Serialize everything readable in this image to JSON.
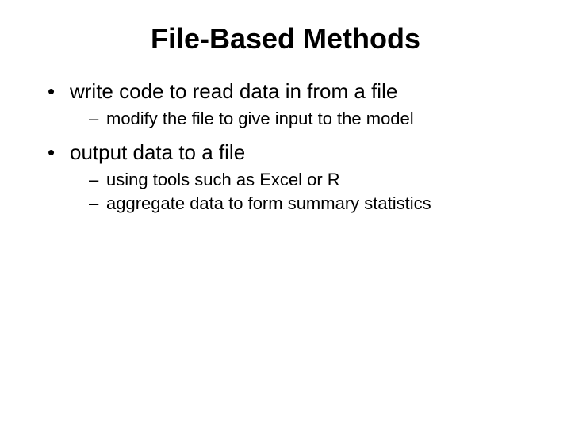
{
  "title": "File-Based Methods",
  "bullets": [
    {
      "text": "write code to read data in from a file",
      "subs": [
        "modify the file to give input to the model"
      ]
    },
    {
      "text": "output data to a file",
      "subs": [
        "using tools such as Excel or R",
        "aggregate data to form summary statistics"
      ]
    }
  ]
}
